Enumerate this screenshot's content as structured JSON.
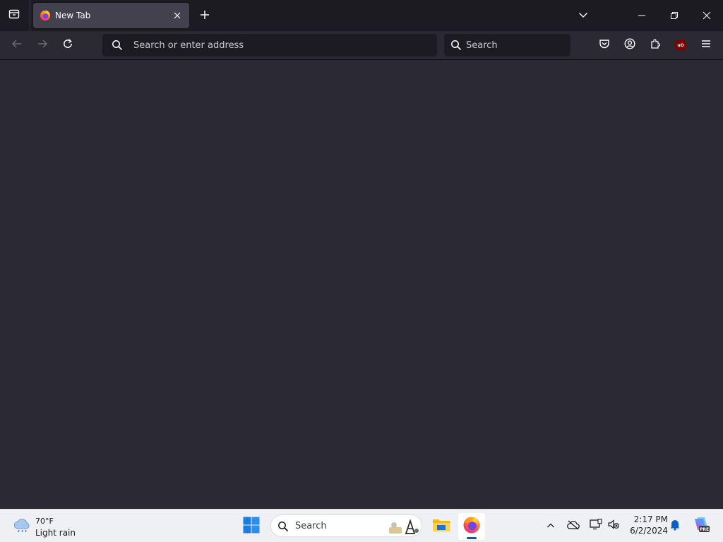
{
  "browser": {
    "tab": {
      "title": "New Tab",
      "favicon": "firefox-logo-icon"
    },
    "urlbar": {
      "placeholder": "Search or enter address",
      "value": ""
    },
    "searchbar": {
      "placeholder": "Search",
      "value": ""
    },
    "toolbar_icons": [
      "back-icon",
      "forward-icon",
      "reload-icon",
      "pocket-icon",
      "account-icon",
      "extensions-icon",
      "ublock-origin-icon",
      "menu-icon"
    ],
    "ublock_badge": "uO"
  },
  "taskbar": {
    "weather": {
      "temp": "70°F",
      "desc": "Light rain",
      "icon": "cloud-rain-icon"
    },
    "search_label": "Search",
    "apps": [
      "windows-start-icon",
      "file-explorer-icon",
      "firefox-icon"
    ],
    "clock": {
      "time": "2:17 PM",
      "date": "6/2/2024"
    },
    "copilot_badge": "PRE"
  },
  "colors": {
    "tabstrip_bg": "#1c1b22",
    "toolbar_bg": "#2b2a33",
    "content_bg": "#2b2a33",
    "taskbar_bg": "#eef0f4",
    "accent": "#005fb8"
  }
}
